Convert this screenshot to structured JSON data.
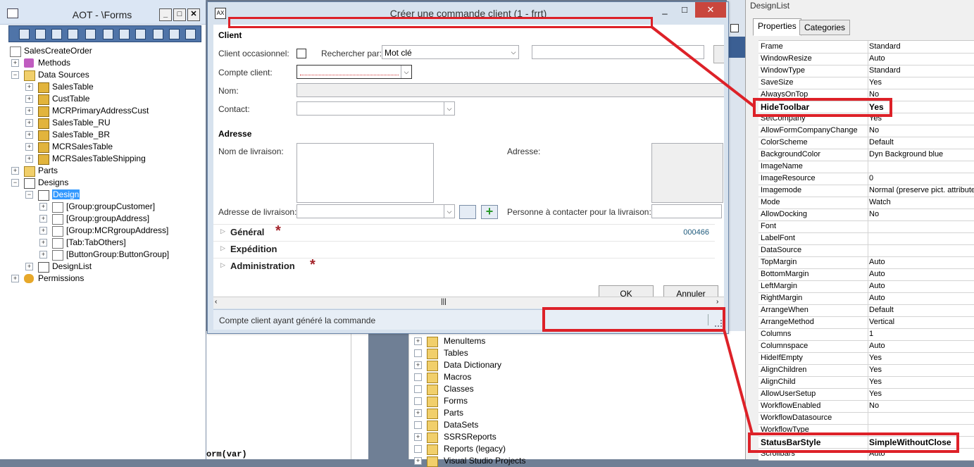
{
  "aot": {
    "title": "AOT - \\Forms",
    "tree": [
      {
        "label": "SalesCreateOrder",
        "depth": 0,
        "icon": "form-icon",
        "exp": ""
      },
      {
        "label": "Methods",
        "depth": 1,
        "icon": "method-icon",
        "exp": "+"
      },
      {
        "label": "Data Sources",
        "depth": 1,
        "icon": "datasource-icon",
        "exp": "−"
      },
      {
        "label": "SalesTable",
        "depth": 2,
        "icon": "table-icon",
        "exp": "+"
      },
      {
        "label": "CustTable",
        "depth": 2,
        "icon": "table-icon",
        "exp": "+"
      },
      {
        "label": "MCRPrimaryAddressCust",
        "depth": 2,
        "icon": "table-icon",
        "exp": "+"
      },
      {
        "label": "SalesTable_RU",
        "depth": 2,
        "icon": "table-icon",
        "exp": "+"
      },
      {
        "label": "SalesTable_BR",
        "depth": 2,
        "icon": "table-icon",
        "exp": "+"
      },
      {
        "label": "MCRSalesTable",
        "depth": 2,
        "icon": "table-icon",
        "exp": "+"
      },
      {
        "label": "MCRSalesTableShipping",
        "depth": 2,
        "icon": "table-icon",
        "exp": "+"
      },
      {
        "label": "Parts",
        "depth": 1,
        "icon": "parts-icon",
        "exp": "+"
      },
      {
        "label": "Designs",
        "depth": 1,
        "icon": "designs-icon",
        "exp": "−"
      },
      {
        "label": "Design",
        "depth": 2,
        "icon": "design-icon",
        "exp": "−",
        "selected": true
      },
      {
        "label": "[Group:groupCustomer]",
        "depth": 3,
        "icon": "group-icon",
        "exp": "+"
      },
      {
        "label": "[Group:groupAddress]",
        "depth": 3,
        "icon": "group-icon",
        "exp": "+"
      },
      {
        "label": "[Group:MCRgroupAddress]",
        "depth": 3,
        "icon": "group-icon",
        "exp": "+"
      },
      {
        "label": "[Tab:TabOthers]",
        "depth": 3,
        "icon": "tab-icon",
        "exp": "+"
      },
      {
        "label": "[ButtonGroup:ButtonGroup]",
        "depth": 3,
        "icon": "buttongroup-icon",
        "exp": "+"
      },
      {
        "label": "DesignList",
        "depth": 2,
        "icon": "design-icon",
        "exp": "+"
      },
      {
        "label": "Permissions",
        "depth": 1,
        "icon": "key-icon",
        "exp": "+"
      }
    ]
  },
  "middle": {
    "code_fragment": "orm(var)",
    "tree": [
      {
        "label": "MenuItems",
        "exp": "+"
      },
      {
        "label": "Tables",
        "exp": ""
      },
      {
        "label": "Data Dictionary",
        "exp": "+"
      },
      {
        "label": "Macros",
        "exp": ""
      },
      {
        "label": "Classes",
        "exp": ""
      },
      {
        "label": "Forms",
        "exp": ""
      },
      {
        "label": "Parts",
        "exp": "+"
      },
      {
        "label": "DataSets",
        "exp": ""
      },
      {
        "label": "SSRSReports",
        "exp": "+"
      },
      {
        "label": "Reports (legacy)",
        "exp": ""
      },
      {
        "label": "Visual Studio Projects",
        "exp": "+"
      }
    ]
  },
  "dialog": {
    "title": "Créer une commande client (1 - frrt)",
    "client_section": "Client",
    "client_occasionnel": "Client occasionnel:",
    "rechercher_par": "Rechercher par:",
    "rechercher_value": "Mot clé",
    "compte_client": "Compte client:",
    "nom": "Nom:",
    "contact": "Contact:",
    "adresse_section": "Adresse",
    "nom_livraison": "Nom de livraison:",
    "adresse": "Adresse:",
    "adresse_livraison": "Adresse de livraison:",
    "personne_contact": "Personne à contacter pour la livraison:",
    "fasttabs": [
      {
        "label": "Général",
        "required": true,
        "value": "000466"
      },
      {
        "label": "Expédition",
        "required": false,
        "value": ""
      },
      {
        "label": "Administration",
        "required": true,
        "value": ""
      }
    ],
    "ok": "OK",
    "annuler": "Annuler",
    "status_text": "Compte client ayant généré la commande"
  },
  "properties": {
    "title": "DesignList",
    "tabs": [
      "Properties",
      "Categories"
    ],
    "rows": [
      {
        "name": "Frame",
        "value": "Standard"
      },
      {
        "name": "WindowResize",
        "value": "Auto"
      },
      {
        "name": "WindowType",
        "value": "Standard"
      },
      {
        "name": "SaveSize",
        "value": "Yes"
      },
      {
        "name": "AlwaysOnTop",
        "value": "No"
      },
      {
        "name": "HideToolbar",
        "value": "Yes",
        "highlight": true
      },
      {
        "name": "SetCompany",
        "value": "Yes"
      },
      {
        "name": "AllowFormCompanyChange",
        "value": "No"
      },
      {
        "name": "ColorScheme",
        "value": "Default"
      },
      {
        "name": "BackgroundColor",
        "value": "Dyn Background blue"
      },
      {
        "name": "ImageName",
        "value": ""
      },
      {
        "name": "ImageResource",
        "value": "0"
      },
      {
        "name": "Imagemode",
        "value": "Normal (preserve pict. attributes"
      },
      {
        "name": "Mode",
        "value": "Watch"
      },
      {
        "name": "AllowDocking",
        "value": "No"
      },
      {
        "name": "Font",
        "value": ""
      },
      {
        "name": "LabelFont",
        "value": ""
      },
      {
        "name": "DataSource",
        "value": ""
      },
      {
        "name": "TopMargin",
        "value": "Auto"
      },
      {
        "name": "BottomMargin",
        "value": "Auto"
      },
      {
        "name": "LeftMargin",
        "value": "Auto"
      },
      {
        "name": "RightMargin",
        "value": "Auto"
      },
      {
        "name": "ArrangeWhen",
        "value": "Default"
      },
      {
        "name": "ArrangeMethod",
        "value": "Vertical"
      },
      {
        "name": "Columns",
        "value": "1"
      },
      {
        "name": "Columnspace",
        "value": "Auto"
      },
      {
        "name": "HideIfEmpty",
        "value": "Yes"
      },
      {
        "name": "AlignChildren",
        "value": "Yes"
      },
      {
        "name": "AlignChild",
        "value": "Yes"
      },
      {
        "name": "AllowUserSetup",
        "value": "Yes"
      },
      {
        "name": "WorkflowEnabled",
        "value": "No"
      },
      {
        "name": "WorkflowDatasource",
        "value": ""
      },
      {
        "name": "WorkflowType",
        "value": ""
      },
      {
        "name": "StatusBarStyle",
        "value": "SimpleWithoutClose",
        "highlight": true
      },
      {
        "name": "Scrollbars",
        "value": "Auto"
      }
    ]
  },
  "colors": {
    "annotation": "#dd2128",
    "selection": "#3399ff",
    "required_star": "#a3232a"
  }
}
